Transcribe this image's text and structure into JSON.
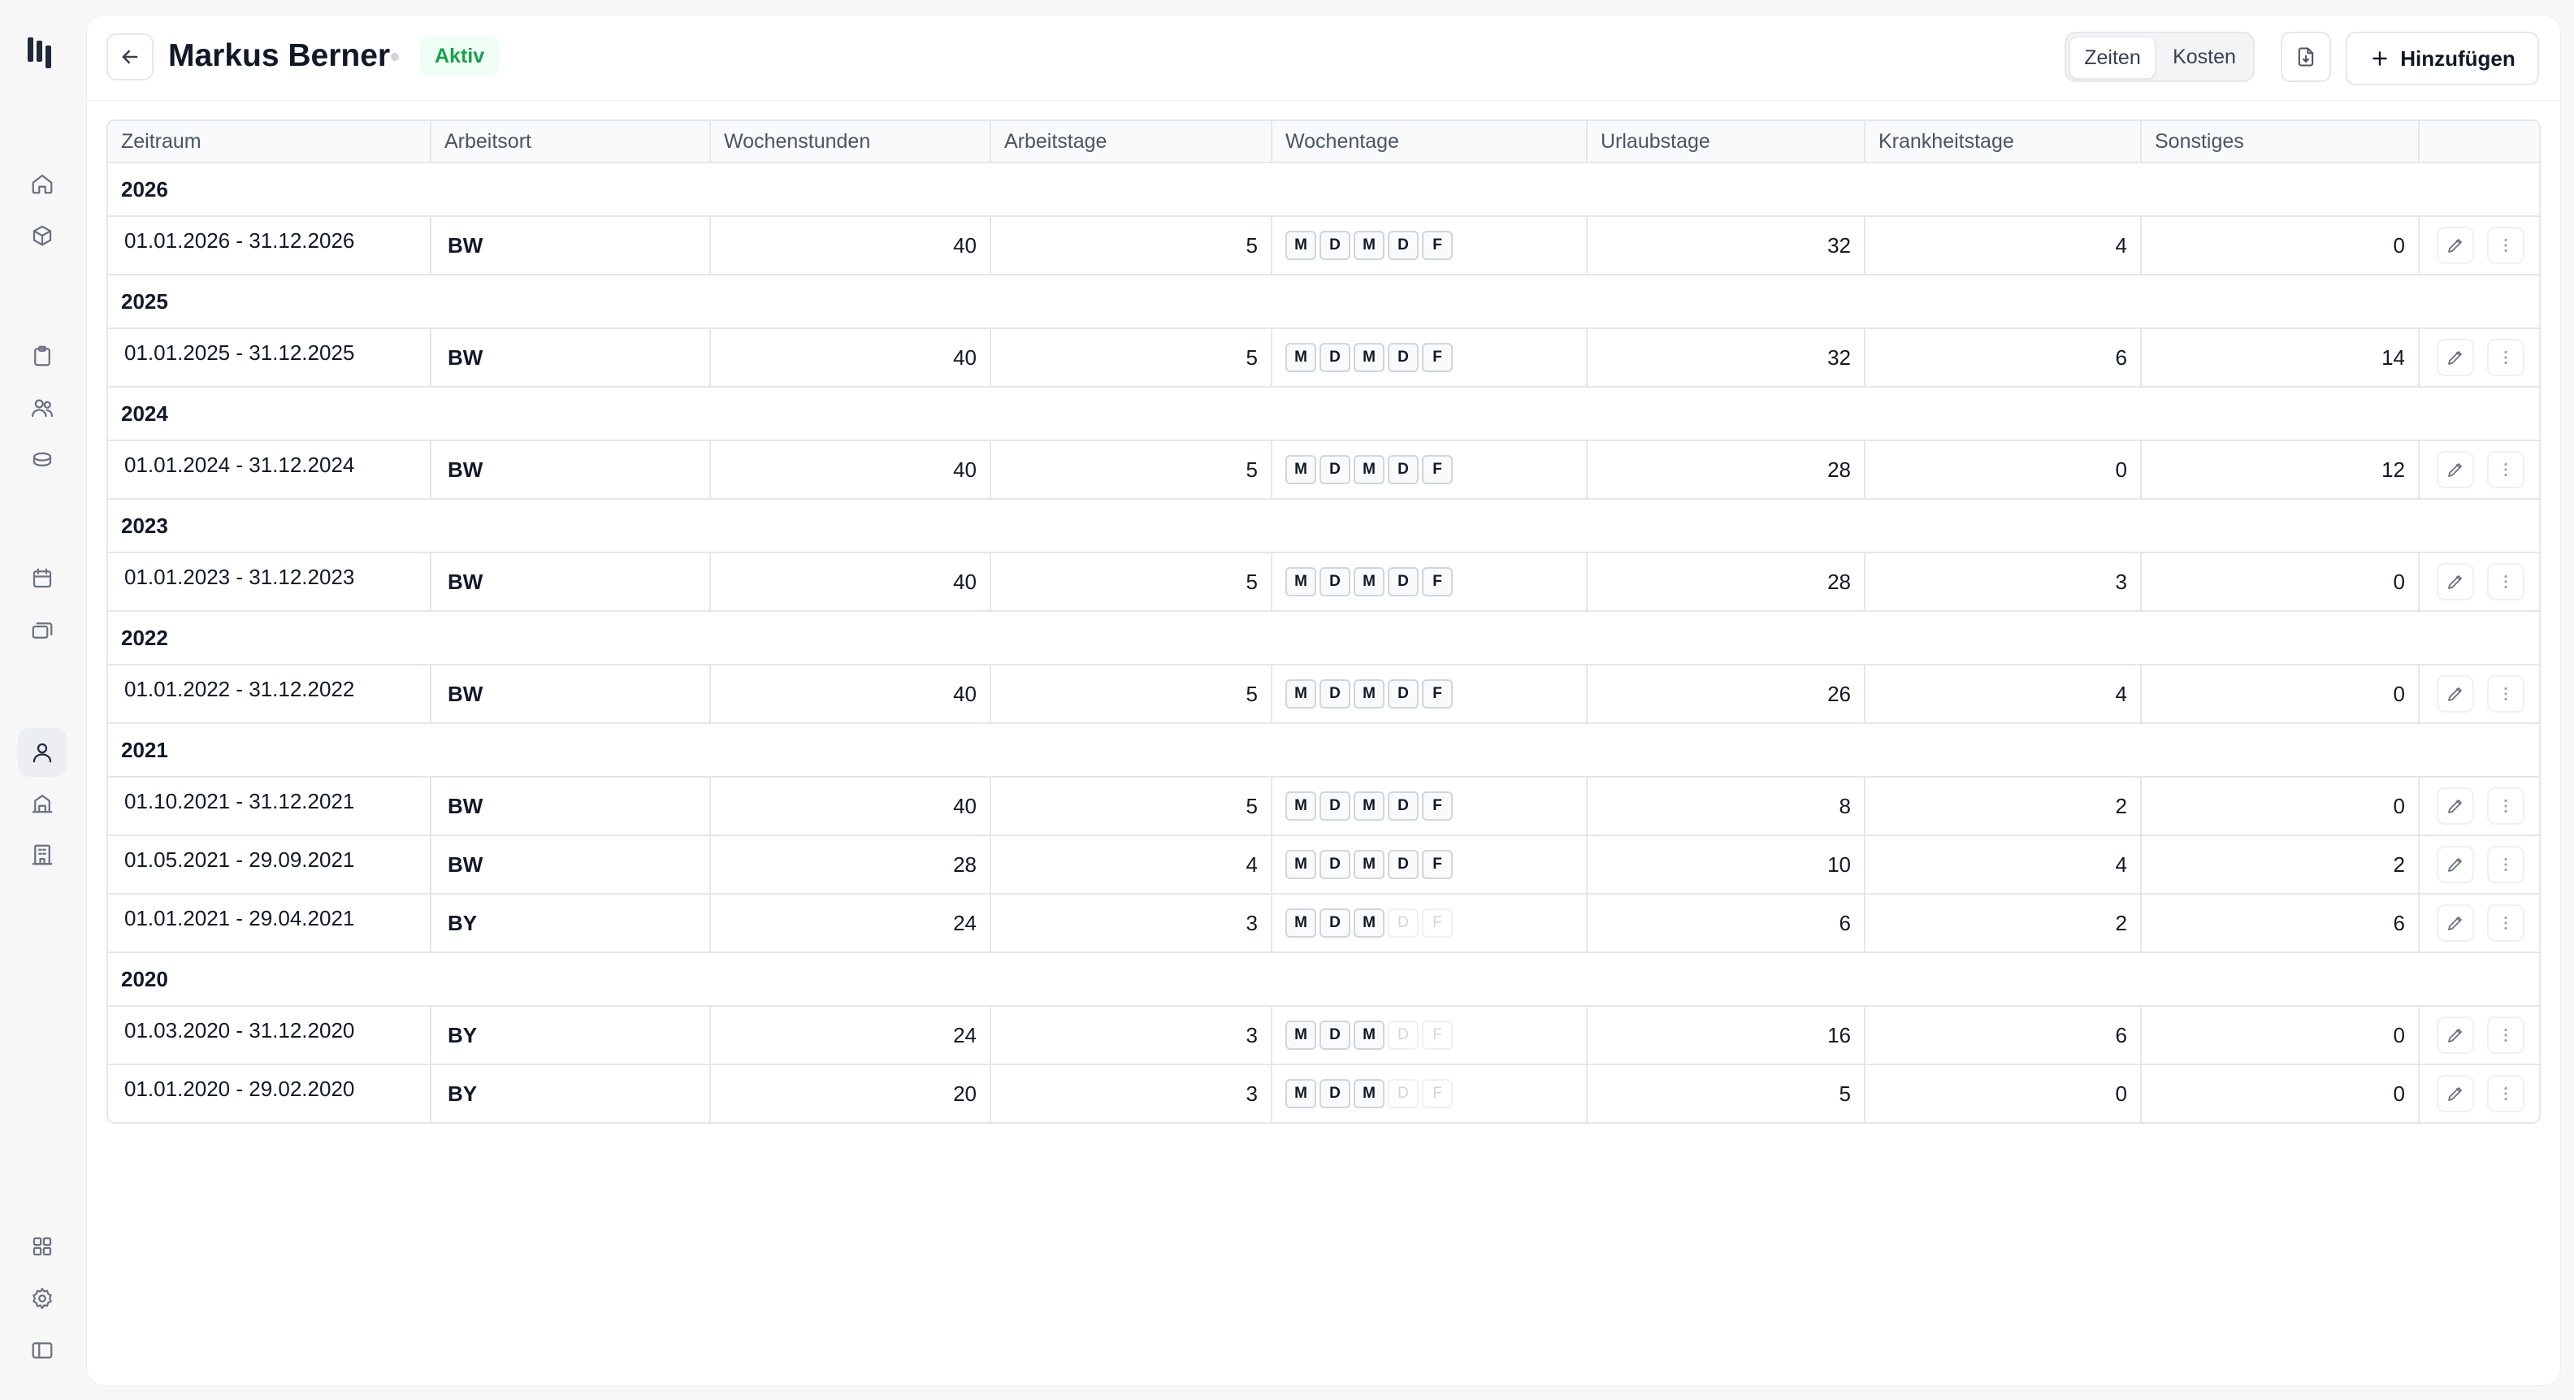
{
  "person": {
    "name": "Markus Berner",
    "status": "Aktiv"
  },
  "toolbar": {
    "view_tabs": [
      "Zeiten",
      "Kosten"
    ],
    "active_tab": "Zeiten",
    "add_label": "Hinzufügen"
  },
  "table": {
    "columns": [
      "Zeitraum",
      "Arbeitsort",
      "Wochenstunden",
      "Arbeitstage",
      "Wochentage",
      "Urlaubstage",
      "Krankheitstage",
      "Sonstiges",
      ""
    ],
    "weekday_letters": [
      "M",
      "D",
      "M",
      "D",
      "F"
    ],
    "groups": [
      {
        "year": "2026",
        "rows": [
          {
            "period": "01.01.2026 - 31.12.2026",
            "location": "BW",
            "hours": "40",
            "workdays": "5",
            "days": [
              true,
              true,
              true,
              true,
              true
            ],
            "vacation": "32",
            "sick": "4",
            "other": "0"
          }
        ]
      },
      {
        "year": "2025",
        "rows": [
          {
            "period": "01.01.2025 - 31.12.2025",
            "location": "BW",
            "hours": "40",
            "workdays": "5",
            "days": [
              true,
              true,
              true,
              true,
              true
            ],
            "vacation": "32",
            "sick": "6",
            "other": "14"
          }
        ]
      },
      {
        "year": "2024",
        "rows": [
          {
            "period": "01.01.2024 - 31.12.2024",
            "location": "BW",
            "hours": "40",
            "workdays": "5",
            "days": [
              true,
              true,
              true,
              true,
              true
            ],
            "vacation": "28",
            "sick": "0",
            "other": "12"
          }
        ]
      },
      {
        "year": "2023",
        "rows": [
          {
            "period": "01.01.2023 - 31.12.2023",
            "location": "BW",
            "hours": "40",
            "workdays": "5",
            "days": [
              true,
              true,
              true,
              true,
              true
            ],
            "vacation": "28",
            "sick": "3",
            "other": "0"
          }
        ]
      },
      {
        "year": "2022",
        "rows": [
          {
            "period": "01.01.2022 - 31.12.2022",
            "location": "BW",
            "hours": "40",
            "workdays": "5",
            "days": [
              true,
              true,
              true,
              true,
              true
            ],
            "vacation": "26",
            "sick": "4",
            "other": "0"
          }
        ]
      },
      {
        "year": "2021",
        "rows": [
          {
            "period": "01.10.2021 - 31.12.2021",
            "location": "BW",
            "hours": "40",
            "workdays": "5",
            "days": [
              true,
              true,
              true,
              true,
              true
            ],
            "vacation": "8",
            "sick": "2",
            "other": "0"
          },
          {
            "period": "01.05.2021 - 29.09.2021",
            "location": "BW",
            "hours": "28",
            "workdays": "4",
            "days": [
              true,
              true,
              true,
              true,
              true
            ],
            "vacation": "10",
            "sick": "4",
            "other": "2"
          },
          {
            "period": "01.01.2021 - 29.04.2021",
            "location": "BY",
            "hours": "24",
            "workdays": "3",
            "days": [
              true,
              true,
              true,
              false,
              false
            ],
            "vacation": "6",
            "sick": "2",
            "other": "6"
          }
        ]
      },
      {
        "year": "2020",
        "rows": [
          {
            "period": "01.03.2020 - 31.12.2020",
            "location": "BY",
            "hours": "24",
            "workdays": "3",
            "days": [
              true,
              true,
              true,
              false,
              false
            ],
            "vacation": "16",
            "sick": "6",
            "other": "0"
          },
          {
            "period": "01.01.2020 - 29.02.2020",
            "location": "BY",
            "hours": "20",
            "workdays": "3",
            "days": [
              true,
              true,
              true,
              false,
              false
            ],
            "vacation": "5",
            "sick": "0",
            "other": "0"
          }
        ]
      }
    ]
  },
  "colors": {
    "accent_green": "#16a34a",
    "badge_bg": "#f0fdf4",
    "border": "#e5e7eb"
  },
  "icons": {
    "sidebar": [
      "home-icon",
      "box-icon",
      "clipboard-icon",
      "users-icon",
      "database-icon",
      "calendar-icon",
      "layers-icon",
      "user-icon",
      "building-icon",
      "office-icon",
      "grid-icon",
      "gear-icon",
      "sidebar-toggle-icon"
    ],
    "row_actions": [
      "pencil-icon",
      "more-vertical-icon"
    ]
  }
}
